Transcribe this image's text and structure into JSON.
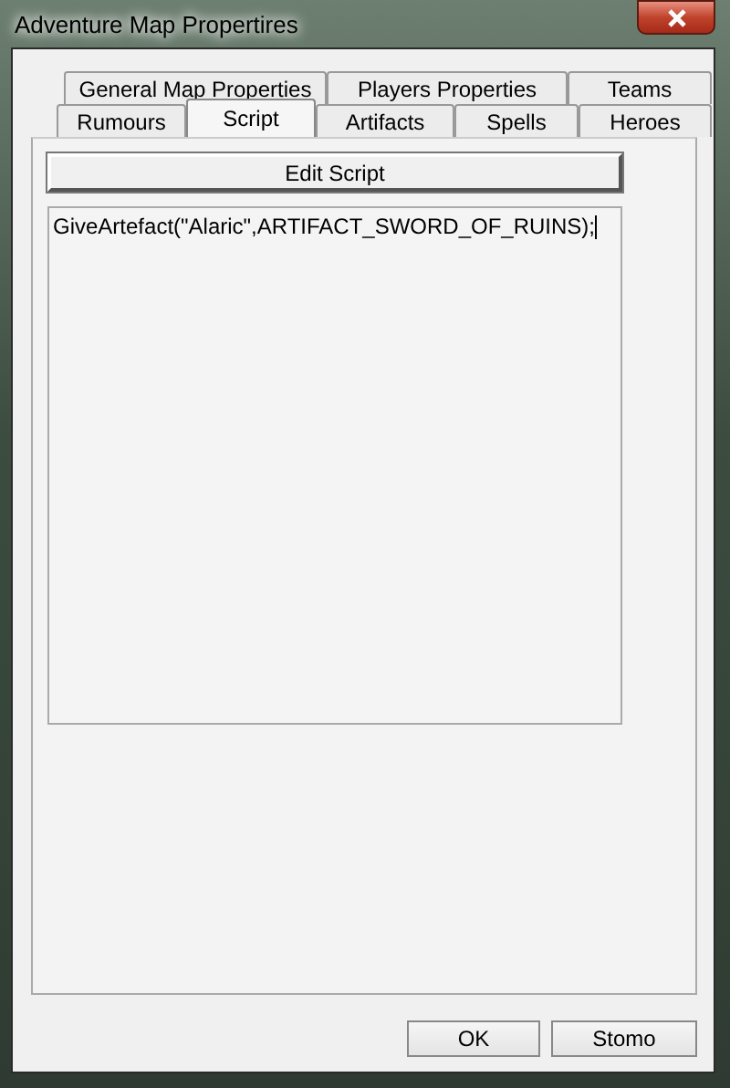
{
  "window": {
    "title": "Adventure Map Propertires"
  },
  "tab_rows": [
    [
      {
        "label": "General Map Properties",
        "selected": false
      },
      {
        "label": "Players Properties",
        "selected": false
      },
      {
        "label": "Teams",
        "selected": false
      }
    ],
    [
      {
        "label": "Rumours",
        "selected": false
      },
      {
        "label": "Script",
        "selected": true
      },
      {
        "label": "Artifacts",
        "selected": false
      },
      {
        "label": "Spells",
        "selected": false
      },
      {
        "label": "Heroes",
        "selected": false
      }
    ]
  ],
  "edit_button": "Edit Script",
  "script_text": "GiveArtefact(\"Alaric\",ARTIFACT_SWORD_OF_RUINS);",
  "buttons": [
    "OK",
    "Stomo"
  ]
}
